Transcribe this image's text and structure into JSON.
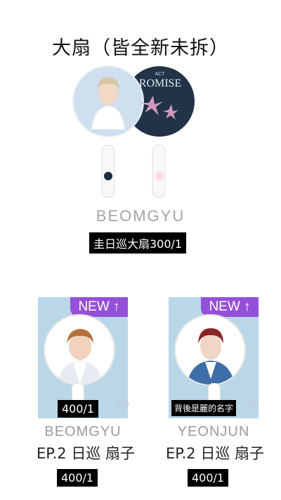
{
  "title": "大扇（皆全新未拆）",
  "top_item": {
    "fan_back_text_top": "ACT",
    "fan_back_text_main": "ROMISE",
    "name": "BEOMGYU",
    "price_label": "圭日巡大扇300/1"
  },
  "cards": [
    {
      "badge": "NEW",
      "badge_arrow": "↑",
      "photo_price": "400/1",
      "name": "BEOMGYU",
      "title": "EP.2 日巡 扇子",
      "price": "400/1"
    },
    {
      "badge": "NEW",
      "badge_arrow": "↑",
      "photo_note": "背後是麗的名字",
      "name": "YEONJUN",
      "title": "EP.2 日巡 扇子",
      "price": "400/1"
    }
  ]
}
